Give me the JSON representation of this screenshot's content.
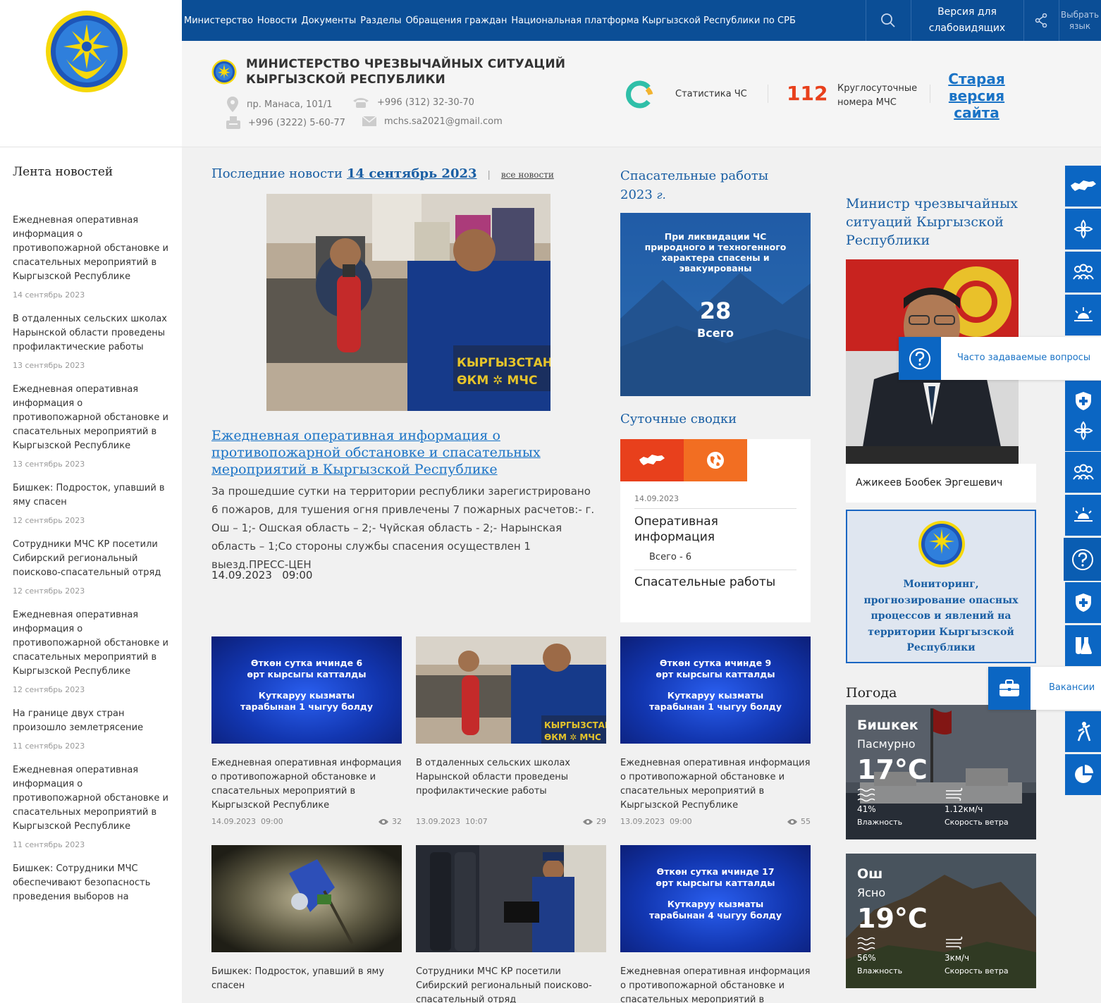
{
  "nav": {
    "items": [
      "Министерство",
      "Новости",
      "Документы",
      "Разделы",
      "Обращения граждан",
      "Национальная платформа Кыргызской Республики по СРБ"
    ],
    "vision_line1": "Версия для",
    "vision_line2": "слабовидящих",
    "lang_line1": "Выбрать",
    "lang_line2": "язык"
  },
  "header": {
    "ministry_line1": "МИНИСТЕРСТВО ЧРЕЗВЫЧАЙНЫХ СИТУАЦИЙ",
    "ministry_line2": "КЫРГЫЗСКОЙ РЕСПУБЛИКИ",
    "address": "пр. Манаса, 101/1",
    "phone": "+996 (312) 32-30-70",
    "fax": "+996 (3222) 5-60-77",
    "email": "mchs.sa2021@gmail.com",
    "stats_label": "Статистика ЧС",
    "emergency_number": "112",
    "emergency_label_line1": "Круглосуточные",
    "emergency_label_line2": "номера МЧС",
    "old_site": "Старая версия сайта"
  },
  "feed": {
    "title": "Лента новостей",
    "items": [
      {
        "title": "Ежедневная оперативная информация о противопожарной обстановке и спасательных мероприятий в Кыргызской Республике",
        "date": "14 сентябрь 2023"
      },
      {
        "title": "В отдаленных сельских школах Нарынской области проведены профилактические работы",
        "date": "13 сентябрь 2023"
      },
      {
        "title": "Ежедневная оперативная информация о противопожарной обстановке и спасательных мероприятий в Кыргызской Республике",
        "date": "13 сентябрь 2023"
      },
      {
        "title": "Бишкек: Подросток, упавший в яму спасен",
        "date": "12 сентябрь 2023"
      },
      {
        "title": "Сотрудники МЧС КР посетили Сибирский региональный поисково-спасательный отряд",
        "date": "12 сентябрь 2023"
      },
      {
        "title": "Ежедневная оперативная информация о противопожарной обстановке и спасательных мероприятий в Кыргызской Республике",
        "date": "12 сентябрь 2023"
      },
      {
        "title": "На границе двух стран произошло землетрясение",
        "date": "11 сентябрь 2023"
      },
      {
        "title": "Ежедневная оперативная информация о противопожарной обстановке и спасательных мероприятий в Кыргызской Республике",
        "date": "11 сентябрь 2023"
      },
      {
        "title": "Бишкек: Сотрудники МЧС обеспечивают безопасность проведения выборов на",
        "date": ""
      }
    ]
  },
  "latest": {
    "label": "Последние новости",
    "date": "14 сентябрь 2023",
    "all_news": "все новости",
    "main_title": "Ежедневная оперативная информация о противопожарной обстановке и спасательных мероприятий в Кыргызской Республике",
    "main_desc": "За прошедшие сутки на территории республики зарегистрировано 6 пожаров, для тушения огня привлечены 7 пожарных расчетов:- г. Ош – 1;- Ошская область – 2;- Чүйская область - 2;- Нарынская область – 1;Со стороны службы спасения осуществлен 1 выезд.ПРЕСС-ЦЕН",
    "main_date": "14.09.2023",
    "main_time": "09:00",
    "photo_badge_1": "КЫРГЫЗСТАН",
    "photo_badge_2": "ӨКМ ✲ МЧС"
  },
  "cards": [
    {
      "kind": "slide",
      "slide_line1": "Өткөн сутка ичинде 6 өрт кырсыгы катталды",
      "slide_line2": "Куткаруу кызматы тарабынан 1 чыгуу болду",
      "title": "Ежедневная оперативная информация о противопожарной обстановке и спасательных мероприятий в Кыргызской Республике",
      "date": "14.09.2023",
      "time": "09:00",
      "views": "32"
    },
    {
      "kind": "photo",
      "title": "В отдаленных сельских школах Нарынской области проведены профилактические работы",
      "date": "13.09.2023",
      "time": "10:07",
      "views": "29"
    },
    {
      "kind": "slide",
      "slide_line1": "Өткөн сутка ичинде 9 өрт кырсыгы катталды",
      "slide_line2": "Куткаруу кызматы тарабынан 1 чыгуу болду",
      "title": "Ежедневная оперативная информация о противопожарной обстановке и спасательных мероприятий в Кыргызской Республике",
      "date": "13.09.2023",
      "time": "09:00",
      "views": "55"
    },
    {
      "kind": "cave",
      "title": "Бишкек: Подросток, упавший в яму спасен"
    },
    {
      "kind": "uniform",
      "title": "Сотрудники МЧС КР посетили Сибирский региональный поисково-спасательный отряд"
    },
    {
      "kind": "slide",
      "slide_line1": "Өткөн сутка ичинде 17 өрт кырсыгы катталды",
      "slide_line2": "Куткаруу кызматы тарабынан 4 чыгуу болду",
      "title": "Ежедневная оперативная информация о противопожарной обстановке и спасательных мероприятий в"
    }
  ],
  "rescue": {
    "title": "Спасательные работы 2023",
    "year_suffix": "г.",
    "box_text": "При ликвидации ЧС природного и техногенного характера спасены и эвакуированы",
    "count": "28",
    "total_label": "Всего"
  },
  "daily": {
    "title": "Суточные сводки",
    "date": "14.09.2023",
    "op_label": "Оперативная информация",
    "count": "Всего - 6",
    "rescue_label": "Спасательные работы"
  },
  "minister": {
    "title": "Министр чрезвычайных ситуаций Кыргызской Республики",
    "name": "Ажикеев Бообек Эргешевич"
  },
  "monitoring": {
    "text": "Мониторинг, прогнозирование опасных процессов и явлений на территории Кыргызской Республики"
  },
  "weather": {
    "title": "Погода",
    "cities": [
      {
        "city": "Бишкек",
        "condition": "Пасмурно",
        "temp": "17°C",
        "humidity": "41%",
        "humidity_label": "Влажность",
        "wind": "1.12км/ч",
        "wind_label": "Скорость ветра"
      },
      {
        "city": "Ош",
        "condition": "Ясно",
        "temp": "19°C",
        "humidity": "56%",
        "humidity_label": "Влажность",
        "wind": "3км/ч",
        "wind_label": "Скорость ветра"
      }
    ]
  },
  "rail": {
    "faq_label": "Часто задаваемые вопросы",
    "vacancies_label": "Вакансии",
    "icons": [
      "kyrgyzstan-map-icon",
      "ornament-icon",
      "people-icon",
      "sunrise-icon",
      "faq-icon",
      "shield-icon",
      "ornament-icon",
      "people-icon",
      "sunrise-icon",
      "question-icon",
      "shield-icon",
      "lab-flask-icon",
      "briefcase-icon",
      "climber-icon",
      "pie-chart-icon"
    ]
  },
  "colors": {
    "nav_bg": "#0b4e96",
    "accent_blue": "#1a73c6",
    "emergency_red": "#e8401c",
    "rail_blue": "#0b66c3"
  }
}
